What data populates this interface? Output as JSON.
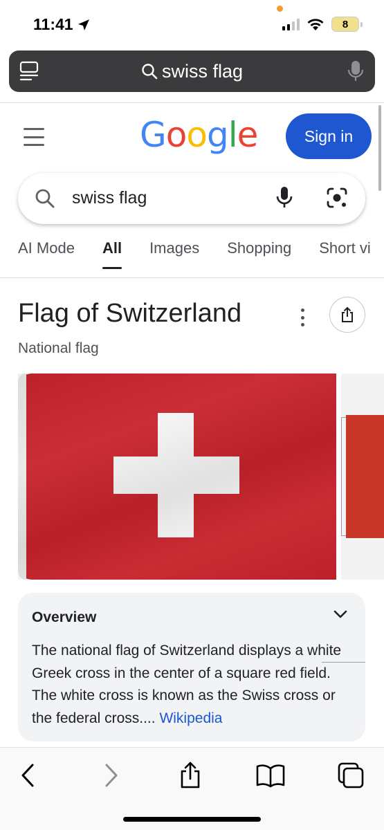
{
  "status_bar": {
    "time": "11:41",
    "battery": "8",
    "colors": {
      "battery": "#f1e08d",
      "privacy_dot": "#f59b36"
    }
  },
  "browser": {
    "address_text": "swiss flag",
    "icons": [
      "tabs-overview-icon",
      "search-icon",
      "microphone-icon"
    ]
  },
  "google": {
    "logo": [
      {
        "char": "G",
        "color": "#4285F4"
      },
      {
        "char": "o",
        "color": "#EA4335"
      },
      {
        "char": "o",
        "color": "#FBBC05"
      },
      {
        "char": "g",
        "color": "#4285F4"
      },
      {
        "char": "l",
        "color": "#34A853"
      },
      {
        "char": "e",
        "color": "#EA4335"
      }
    ],
    "sign_in_label": "Sign in",
    "sign_in_color": "#1f57d1",
    "search_query": "swiss flag"
  },
  "tabs": [
    {
      "label": "AI Mode",
      "active": false
    },
    {
      "label": "All",
      "active": true
    },
    {
      "label": "Images",
      "active": false
    },
    {
      "label": "Shopping",
      "active": false
    },
    {
      "label": "Short vi",
      "active": false
    }
  ],
  "knowledge_panel": {
    "title": "Flag of Switzerland",
    "subtitle": "National flag",
    "flag_color": "#c8232b",
    "overview": {
      "heading": "Overview",
      "text": "The national flag of Switzerland displays a white Greek cross in the center of a square red field. The white cross is known as the Swiss cross or the federal cross.",
      "ellipsis": "... ",
      "link_text": "Wikipedia",
      "link_color": "#1a57d6"
    }
  },
  "toolbar": {
    "buttons": [
      "back-icon",
      "forward-icon",
      "share-icon",
      "bookmarks-icon",
      "tabs-icon"
    ]
  }
}
